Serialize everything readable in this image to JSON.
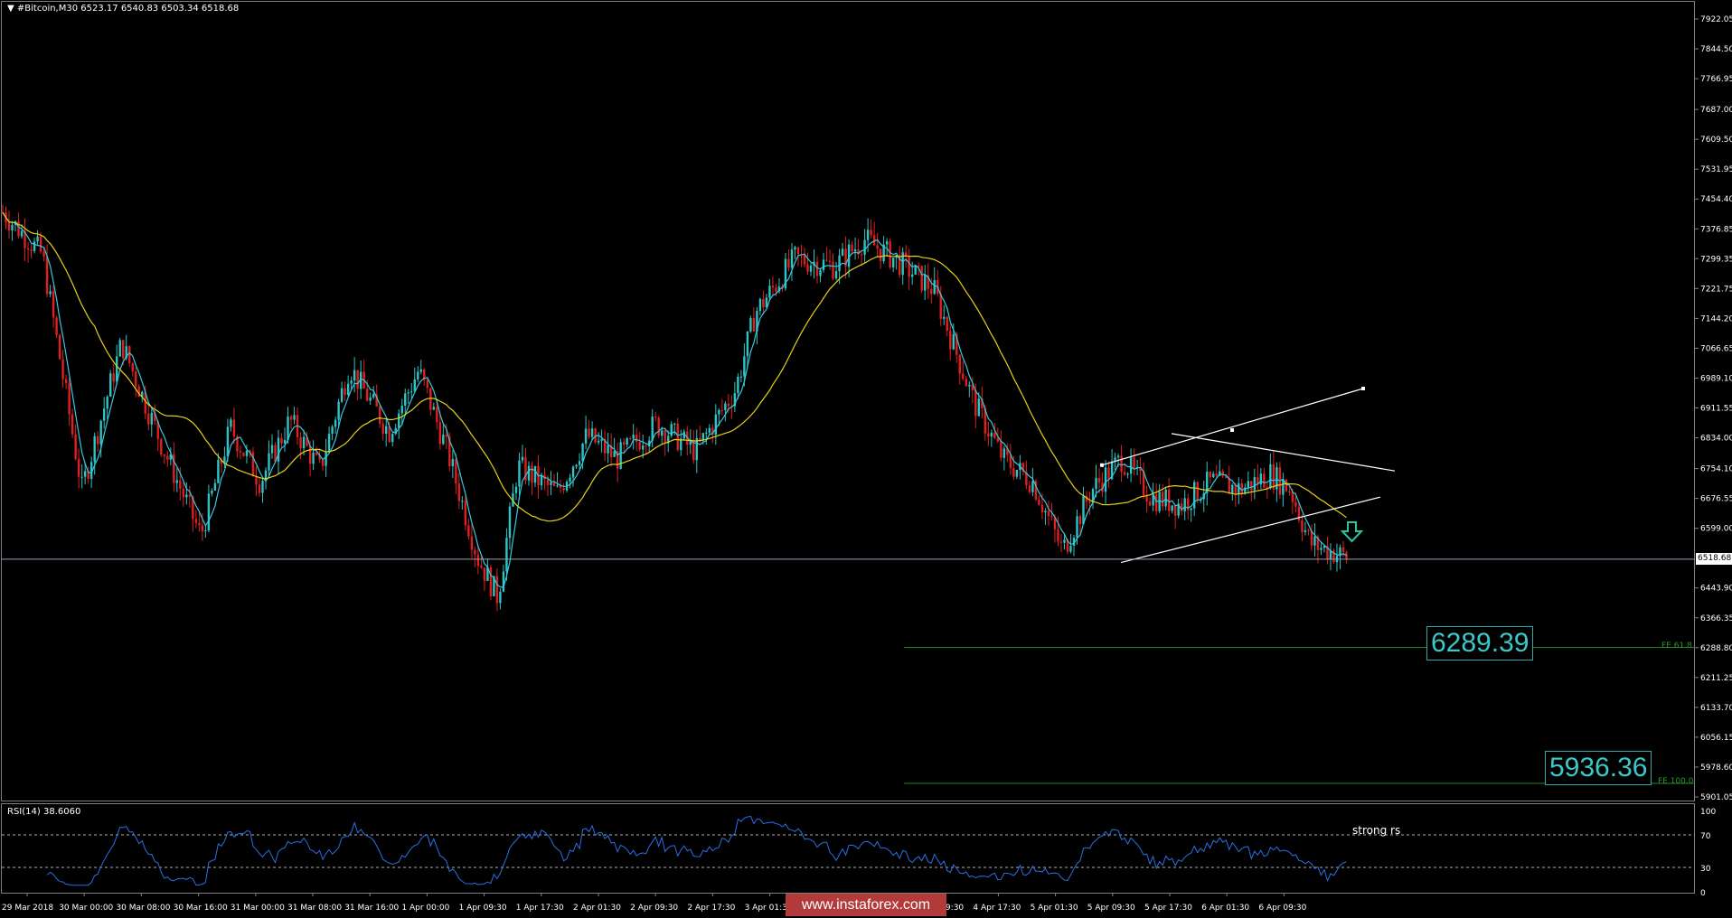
{
  "header": {
    "symbol": "#Bitcoin,M30",
    "ohlc": "6523.17 6540.83 6503.34 6518.68",
    "menu_icon": "triangle-down-icon"
  },
  "price_axis": {
    "labels": [
      "7922.05",
      "7844.50",
      "7766.95",
      "7687.00",
      "7609.50",
      "7531.95",
      "7454.40",
      "7376.85",
      "7299.35",
      "7221.75",
      "7144.20",
      "7066.65",
      "6989.10",
      "6911.55",
      "6834.00",
      "6754.10",
      "6676.55",
      "6599.00",
      "6518.68",
      "6443.90",
      "6366.35",
      "6288.80",
      "6211.25",
      "6133.70",
      "6056.15",
      "5978.60",
      "5901.05"
    ],
    "current_price": "6518.68"
  },
  "time_axis": {
    "labels": [
      "29 Mar 2018",
      "30 Mar 00:00",
      "30 Mar 08:00",
      "30 Mar 16:00",
      "31 Mar 00:00",
      "31 Mar 08:00",
      "31 Mar 16:00",
      "1 Apr 00:00",
      "1 Apr 09:30",
      "1 Apr 17:30",
      "2 Apr 01:30",
      "2 Apr 09:30",
      "2 Apr 17:30",
      "3 Apr 01:30",
      "3 Apr 09:30",
      "4 Apr 01:30",
      "4 Apr 09:30",
      "4 Apr 17:30",
      "5 Apr 01:30",
      "5 Apr 09:30",
      "5 Apr 17:30",
      "6 Apr 01:30",
      "6 Apr 09:30"
    ]
  },
  "targets": {
    "fe1": {
      "value": "6289.39",
      "tag": "FE 61.8"
    },
    "fe2": {
      "value": "5936.36",
      "tag": "FE 100.0"
    }
  },
  "rsi": {
    "label": "RSI(14) 38.6060",
    "levels": [
      "100",
      "70",
      "30",
      "0"
    ],
    "annotation": "strong rs"
  },
  "watermark": "www.instaforex.com",
  "colors": {
    "bull": "#2ec4c4",
    "bear": "#e01f1f",
    "ma_fast": "#36c9e0",
    "ma_slow": "#e6d11a",
    "rsi_line": "#2a6fe6",
    "fe_line": "#1f8a1f",
    "target_text": "#3cc8c8",
    "watermark_bg": "#b33a3a"
  },
  "chart_data": {
    "type": "candlestick",
    "instrument": "#Bitcoin",
    "timeframe": "M30",
    "ylim": [
      5901.05,
      7960
    ],
    "close_path": [
      [
        0,
        7420
      ],
      [
        40,
        7310
      ],
      [
        80,
        6700
      ],
      [
        120,
        7080
      ],
      [
        160,
        6820
      ],
      [
        200,
        6580
      ],
      [
        230,
        6860
      ],
      [
        260,
        6720
      ],
      [
        290,
        6880
      ],
      [
        320,
        6750
      ],
      [
        350,
        7020
      ],
      [
        390,
        6850
      ],
      [
        420,
        7010
      ],
      [
        450,
        6790
      ],
      [
        480,
        6520
      ],
      [
        500,
        6420
      ],
      [
        520,
        6760
      ],
      [
        560,
        6690
      ],
      [
        590,
        6840
      ],
      [
        620,
        6780
      ],
      [
        660,
        6870
      ],
      [
        700,
        6800
      ],
      [
        740,
        6960
      ],
      [
        760,
        7160
      ],
      [
        800,
        7300
      ],
      [
        840,
        7280
      ],
      [
        870,
        7350
      ],
      [
        900,
        7300
      ],
      [
        940,
        7220
      ],
      [
        980,
        6930
      ],
      [
        1010,
        6780
      ],
      [
        1040,
        6720
      ],
      [
        1070,
        6540
      ],
      [
        1100,
        6700
      ],
      [
        1130,
        6780
      ],
      [
        1160,
        6680
      ],
      [
        1190,
        6660
      ],
      [
        1220,
        6720
      ],
      [
        1250,
        6700
      ],
      [
        1280,
        6740
      ],
      [
        1300,
        6700
      ],
      [
        1320,
        6560
      ],
      [
        1360,
        6520
      ]
    ]
  }
}
